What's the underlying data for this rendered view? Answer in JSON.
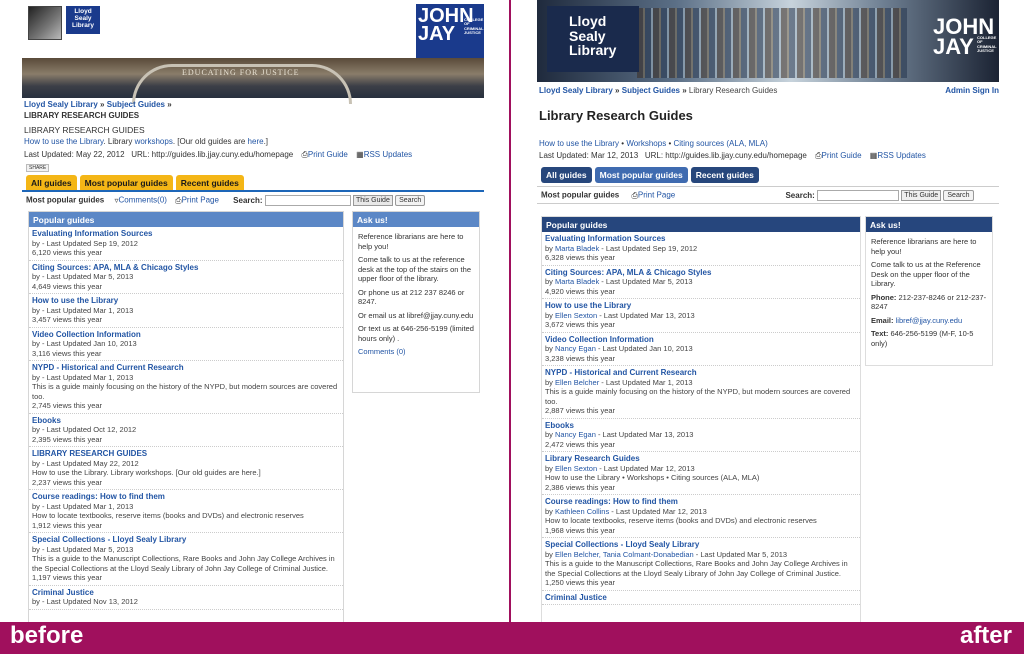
{
  "labels": {
    "before": "before",
    "after": "after"
  },
  "before": {
    "logo": "Lloyd Sealy Library",
    "jj": {
      "big": "JOHN JAY",
      "small": "COLLEGE OF CRIMINAL JUSTICE"
    },
    "banner_text": "EDUCATING FOR JUSTICE",
    "breadcrumb": {
      "home": "Lloyd Sealy Library",
      "sep": "»",
      "guides": "Subject Guides",
      "sep2": "»"
    },
    "page_heading": "LIBRARY RESEARCH GUIDES",
    "page_title": "LIBRARY RESEARCH GUIDES",
    "desc": {
      "l1": "How to use the Library",
      "mid": ". Library ",
      "l2": "workshops",
      "mid2": ". [Our old guides are ",
      "l3": "here",
      "end": ".]"
    },
    "meta": {
      "updated": "Last Updated: May 22, 2012",
      "url": "URL: http://guides.lib.jjay.cuny.edu/homepage",
      "print": "Print Guide",
      "rss": "RSS Updates"
    },
    "share": "SHARE",
    "tabs": [
      "All guides",
      "Most popular guides",
      "Recent guides"
    ],
    "bar": {
      "name": "Most popular guides",
      "comments": "Comments(0)",
      "print": "Print Page",
      "search": "Search:",
      "scope": "This Guide",
      "button": "Search"
    },
    "popular_head": "Popular guides",
    "guides": [
      {
        "t": "Evaluating Information Sources",
        "m": "by - Last Updated Sep 19, 2012",
        "d": "",
        "v": "6,120 views this year"
      },
      {
        "t": "Citing Sources: APA, MLA & Chicago Styles",
        "m": "by - Last Updated Mar 5, 2013",
        "d": "",
        "v": "4,649 views this year"
      },
      {
        "t": "How to use the Library",
        "m": "by - Last Updated Mar 1, 2013",
        "d": "",
        "v": "3,457 views this year"
      },
      {
        "t": "Video Collection Information",
        "m": "by - Last Updated Jan 10, 2013",
        "d": "",
        "v": "3,116 views this year"
      },
      {
        "t": "NYPD - Historical and Current Research",
        "m": "by - Last Updated Mar 1, 2013",
        "d": "This is a guide mainly focusing on the history of the NYPD, but modern sources are covered too.",
        "v": "2,745 views this year"
      },
      {
        "t": "Ebooks",
        "m": "by - Last Updated Oct 12, 2012",
        "d": "",
        "v": "2,395 views this year"
      },
      {
        "t": "LIBRARY RESEARCH GUIDES",
        "m": "by - Last Updated May 22, 2012",
        "d": "How to use the Library. Library workshops. [Our old guides are here.]",
        "v": "2,237 views this year"
      },
      {
        "t": "Course readings: How to find them",
        "m": "by - Last Updated Mar 1, 2013",
        "d": "How to locate textbooks, reserve items (books and DVDs) and electronic reserves",
        "v": "1,912 views this year"
      },
      {
        "t": "Special Collections - Lloyd Sealy Library",
        "m": "by - Last Updated Mar 5, 2013",
        "d": "This is a guide to the Manuscript Collections, Rare Books and John Jay College Archives in the Special Collections at the Lloyd Sealy Library of John Jay College of Criminal Justice.",
        "v": "1,197 views this year"
      },
      {
        "t": "Criminal Justice",
        "m": "by - Last Updated Nov 13, 2012",
        "d": "",
        "v": ""
      }
    ],
    "ask_head": "Ask us!",
    "ask": [
      "Reference librarians are here to help you!",
      "Come talk to us at the reference desk at the top of the stairs on the upper floor of the library.",
      "Or phone us at 212 237 8246 or 8247.",
      "Or email us at libref@jjay.cuny.edu",
      "Or text us at 646-256-5199 (limited hours only) .",
      "Comments (0)"
    ]
  },
  "after": {
    "logo": "Lloyd Sealy Library",
    "jj": {
      "big": "JOHN JAY",
      "small": "COLLEGE OF CRIMINAL JUSTICE"
    },
    "breadcrumb": {
      "home": "Lloyd Sealy Library",
      "sep": "»",
      "guides": "Subject Guides",
      "sep2": "»",
      "current": "Library Research Guides",
      "admin": "Admin Sign In"
    },
    "page_title": "Library Research Guides",
    "desc": {
      "a": "How to use the Library",
      "b": "Workshops",
      "c": "Citing sources (ALA, MLA)",
      "sep": "•"
    },
    "meta": {
      "updated": "Last Updated: Mar 12, 2013",
      "url": "URL: http://guides.lib.jjay.cuny.edu/homepage",
      "print": "Print Guide",
      "rss": "RSS Updates"
    },
    "tabs": [
      "All guides",
      "Most popular guides",
      "Recent guides"
    ],
    "bar": {
      "name": "Most popular guides",
      "print": "Print Page",
      "search": "Search:",
      "scope": "This Guide",
      "button": "Search"
    },
    "popular_head": "Popular guides",
    "guides": [
      {
        "t": "Evaluating Information Sources",
        "by": "Marta Bladek",
        "m": " - Last Updated Sep 19, 2012",
        "d": "",
        "v": "6,328 views this year"
      },
      {
        "t": "Citing Sources: APA, MLA & Chicago Styles",
        "by": "Marta Bladek",
        "m": " - Last Updated Mar 5, 2013",
        "d": "",
        "v": "4,920 views this year"
      },
      {
        "t": "How to use the Library",
        "by": "Ellen Sexton",
        "m": " - Last Updated Mar 13, 2013",
        "d": "",
        "v": "3,672 views this year"
      },
      {
        "t": "Video Collection Information",
        "by": "Nancy Egan",
        "m": " - Last Updated Jan 10, 2013",
        "d": "",
        "v": "3,238 views this year"
      },
      {
        "t": "NYPD - Historical and Current Research",
        "by": "Ellen Belcher",
        "m": " - Last Updated Mar 1, 2013",
        "d": "This is a guide mainly focusing on the history of the NYPD, but modern sources are covered too.",
        "v": "2,887 views this year"
      },
      {
        "t": "Ebooks",
        "by": "Nancy Egan",
        "m": " - Last Updated Mar 13, 2013",
        "d": "",
        "v": "2,472 views this year"
      },
      {
        "t": "Library Research Guides",
        "by": "Ellen Sexton",
        "m": " - Last Updated Mar 12, 2013",
        "d": "How to use the Library • Workshops • Citing sources (ALA, MLA)",
        "v": "2,386 views this year"
      },
      {
        "t": "Course readings: How to find them",
        "by": "Kathleen Collins",
        "m": " - Last Updated Mar 12, 2013",
        "d": "How to locate textbooks, reserve items (books and DVDs) and electronic reserves",
        "v": "1,968 views this year"
      },
      {
        "t": "Special Collections - Lloyd Sealy Library",
        "by": "Ellen Belcher, Tania Colmant-Donabedian",
        "m": " - Last Updated Mar 5, 2013",
        "d": "This is a guide to the Manuscript Collections, Rare Books and John Jay College Archives in the Special Collections at the Lloyd Sealy Library of John Jay College of Criminal Justice.",
        "v": "1,250 views this year"
      },
      {
        "t": "Criminal Justice",
        "by": "",
        "m": "",
        "d": "",
        "v": ""
      }
    ],
    "ask_head": "Ask us!",
    "ask": {
      "p1": "Reference librarians are here to help you!",
      "p2": "Come talk to us at the Reference Desk on the upper floor of the Library.",
      "phone_l": "Phone:",
      "phone": "212-237-8246 or 212-237-8247",
      "email_l": "Email:",
      "email": "libref@jjay.cuny.edu",
      "text_l": "Text:",
      "text": "646-256-5199 (M-F, 10-5 only)"
    }
  }
}
